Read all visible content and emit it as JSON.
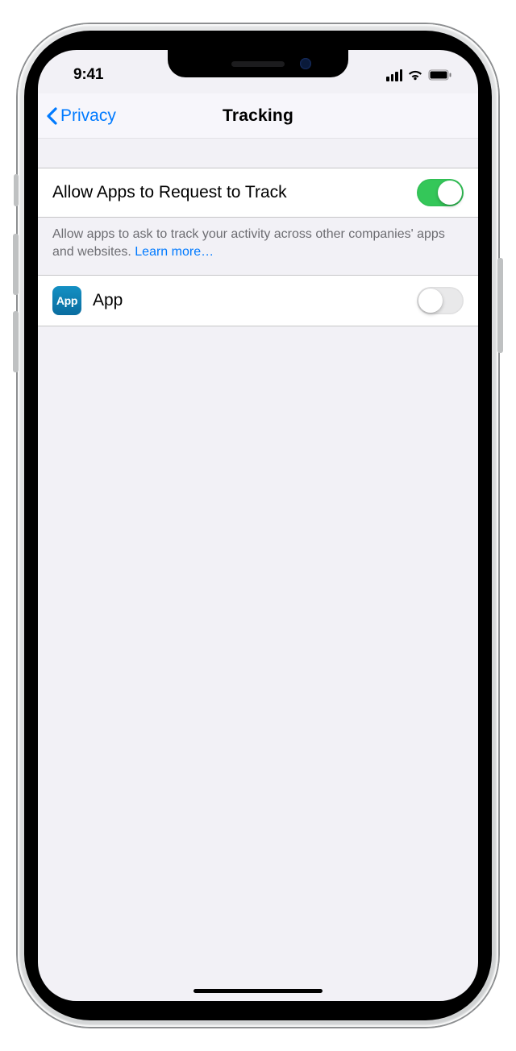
{
  "status": {
    "time": "9:41"
  },
  "nav": {
    "back_label": "Privacy",
    "title": "Tracking"
  },
  "main_toggle": {
    "label": "Allow Apps to Request to Track",
    "on": true,
    "footer_text": "Allow apps to ask to track your activity across other companies' apps and websites. ",
    "learn_more": "Learn more…"
  },
  "apps": [
    {
      "icon_label": "App",
      "name": "App",
      "on": false
    }
  ]
}
